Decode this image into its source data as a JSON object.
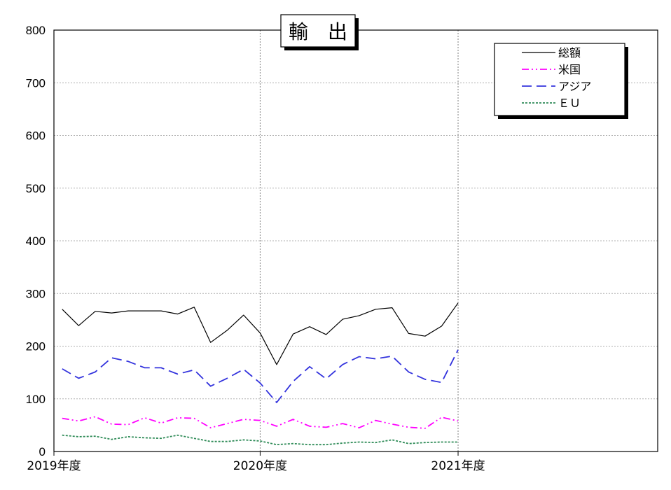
{
  "chart_data": {
    "type": "line",
    "title": "輸　出",
    "xlabel": "",
    "ylabel": "",
    "ylim": [
      0,
      800
    ],
    "yticks": [
      0,
      100,
      200,
      300,
      400,
      500,
      600,
      700,
      800
    ],
    "x_tick_labels": [
      "2019年度",
      "2020年度",
      "2021年度"
    ],
    "months_per_year": 12,
    "grid": true,
    "legend_position": "top-right",
    "series": [
      {
        "name": "総額",
        "color": "#000000",
        "dash": "solid",
        "values": [
          270,
          239,
          266,
          263,
          267,
          267,
          267,
          261,
          274,
          207,
          230,
          259,
          225,
          165,
          223,
          237,
          222,
          251,
          258,
          270,
          273,
          224,
          219,
          238,
          282
        ]
      },
      {
        "name": "米国",
        "color": "#ff00ff",
        "dash": "dashdotdot",
        "values": [
          63,
          58,
          66,
          52,
          51,
          64,
          54,
          64,
          63,
          45,
          53,
          61,
          59,
          48,
          61,
          48,
          46,
          53,
          45,
          59,
          52,
          46,
          44,
          65,
          58
        ]
      },
      {
        "name": "アジア",
        "color": "#3333dd",
        "dash": "longdash",
        "values": [
          157,
          139,
          151,
          178,
          171,
          159,
          159,
          147,
          155,
          124,
          139,
          156,
          130,
          93,
          133,
          161,
          138,
          165,
          180,
          176,
          181,
          151,
          137,
          131,
          193
        ]
      },
      {
        "name": "ＥＵ",
        "color": "#2e8b57",
        "dash": "dotted",
        "values": [
          31,
          28,
          29,
          23,
          28,
          26,
          25,
          31,
          25,
          19,
          19,
          22,
          20,
          13,
          15,
          13,
          13,
          16,
          18,
          17,
          22,
          15,
          17,
          18,
          18
        ]
      }
    ]
  }
}
